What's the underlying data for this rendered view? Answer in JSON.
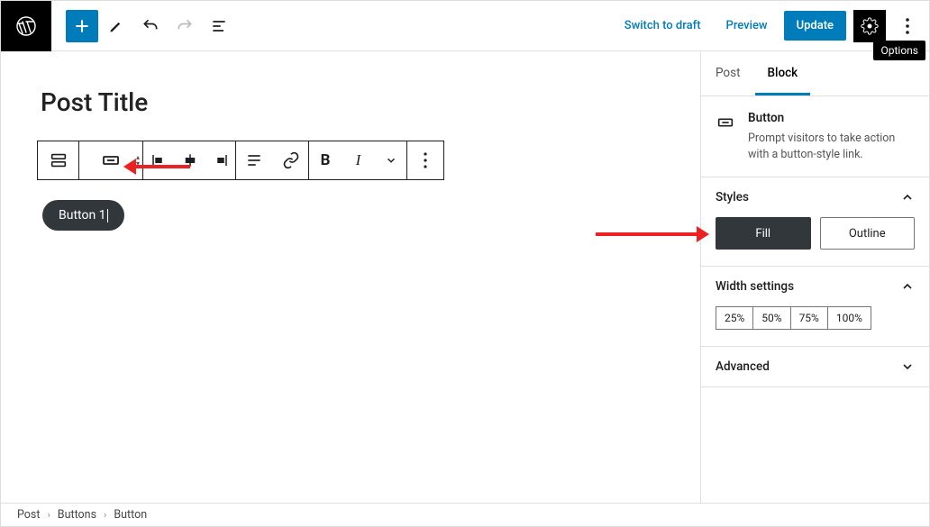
{
  "top": {
    "switch_to_draft": "Switch to draft",
    "preview": "Preview",
    "update": "Update",
    "options_tooltip": "Options"
  },
  "tabs": {
    "post": "Post",
    "block": "Block"
  },
  "block_info": {
    "name": "Button",
    "description": "Prompt visitors to take action with a button-style link."
  },
  "panels": {
    "styles": {
      "title": "Styles",
      "fill": "Fill",
      "outline": "Outline"
    },
    "width": {
      "title": "Width settings",
      "options": [
        "25%",
        "50%",
        "75%",
        "100%"
      ]
    },
    "advanced": {
      "title": "Advanced"
    }
  },
  "canvas": {
    "post_title": "Post Title",
    "button_text": "Button 1"
  },
  "breadcrumb": [
    "Post",
    "Buttons",
    "Button"
  ]
}
